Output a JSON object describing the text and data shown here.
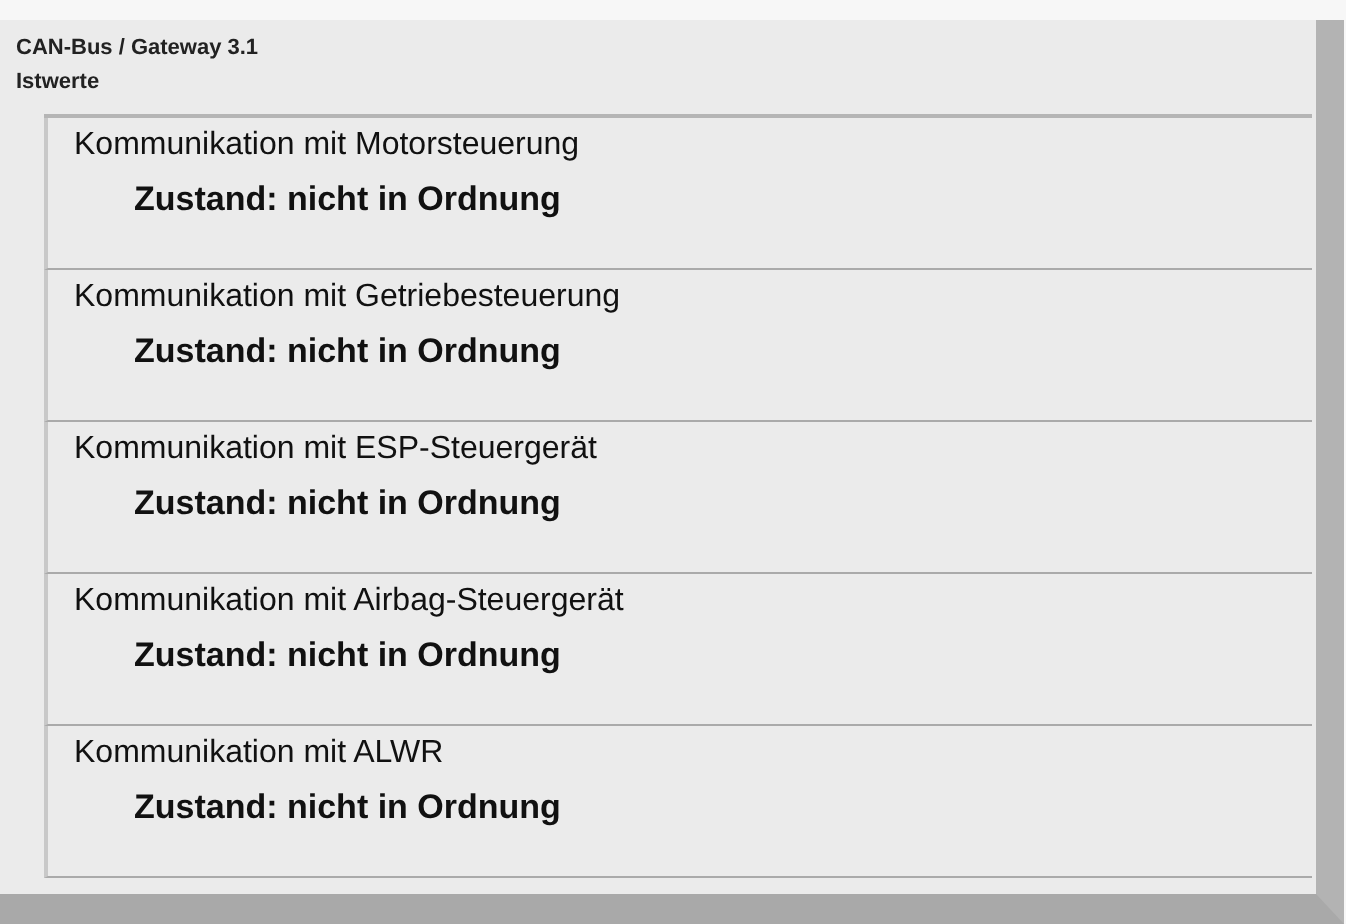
{
  "breadcrumb": "CAN-Bus / Gateway 3.1",
  "section": "Istwerte",
  "entries": [
    {
      "title": "Kommunikation mit Motorsteuerung",
      "status": "Zustand: nicht in Ordnung"
    },
    {
      "title": "Kommunikation mit Getriebesteuerung",
      "status": "Zustand: nicht in Ordnung"
    },
    {
      "title": "Kommunikation mit ESP-Steuergerät",
      "status": "Zustand: nicht in Ordnung"
    },
    {
      "title": "Kommunikation mit Airbag-Steuergerät",
      "status": "Zustand: nicht in Ordnung"
    },
    {
      "title": "Kommunikation mit ALWR",
      "status": "Zustand: nicht in Ordnung"
    }
  ]
}
